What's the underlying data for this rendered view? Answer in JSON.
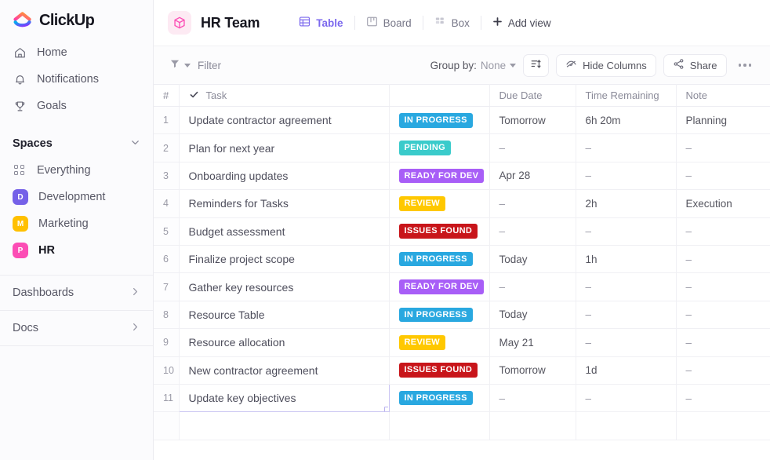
{
  "brand": {
    "name": "ClickUp",
    "accent": "#7b68ee",
    "logo_icon": "clickup-logo-icon"
  },
  "sidebar": {
    "nav": [
      {
        "label": "Home",
        "icon": "home-icon"
      },
      {
        "label": "Notifications",
        "icon": "bell-icon"
      },
      {
        "label": "Goals",
        "icon": "trophy-icon"
      }
    ],
    "spaces_section": {
      "title": "Spaces",
      "chevron_icon": "chevron-down-icon"
    },
    "spaces": [
      {
        "label": "Everything",
        "icon": "grid-dots-icon",
        "initial": "",
        "color": "",
        "active": false
      },
      {
        "label": "Development",
        "icon": "space-badge",
        "initial": "D",
        "color": "#7561e8",
        "active": false
      },
      {
        "label": "Marketing",
        "icon": "space-badge",
        "initial": "M",
        "color": "#ffc000",
        "active": false
      },
      {
        "label": "HR",
        "icon": "space-badge",
        "initial": "P",
        "color": "#fc4db5",
        "active": true
      }
    ],
    "footer": [
      {
        "label": "Dashboards",
        "icon": "chevron-right-icon"
      },
      {
        "label": "Docs",
        "icon": "chevron-right-icon"
      }
    ]
  },
  "header": {
    "list_icon": "box-cube-icon",
    "list_icon_color": "#fc4db5",
    "title": "HR Team",
    "views": [
      {
        "label": "Table",
        "icon": "table-grid-icon",
        "active": true
      },
      {
        "label": "Board",
        "icon": "board-kanban-icon",
        "active": false
      },
      {
        "label": "Box",
        "icon": "box-squares-icon",
        "active": false
      }
    ],
    "add_view": {
      "label": "Add view",
      "icon": "plus-icon"
    }
  },
  "toolbar": {
    "filter": {
      "label": "Filter",
      "icon": "funnel-icon"
    },
    "group_by_label": "Group by:",
    "group_by_value": "None",
    "sort_button_icon": "sort-lines-icon",
    "hide_columns": {
      "label": "Hide Columns",
      "icon": "eye-slash-icon"
    },
    "share": {
      "label": "Share",
      "icon": "share-nodes-icon"
    },
    "more_icon": "ellipsis-icon"
  },
  "table": {
    "columns": [
      "#",
      "Task",
      "",
      "Due Date",
      "Time Remaining",
      "Note"
    ],
    "task_header_check_icon": "check-icon",
    "status_colors": {
      "IN PROGRESS": "#29a8e0",
      "PENDING": "#3acbcb",
      "READY FOR DEV": "#a85ef7",
      "REVIEW": "#ffc800",
      "ISSUES FOUND": "#c8151a"
    },
    "rows": [
      {
        "num": "1",
        "task": "Update contractor agreement",
        "status": "IN PROGRESS",
        "due": "Tomorrow",
        "due_style": "normal",
        "time": "6h 20m",
        "note": "Planning",
        "selected": false
      },
      {
        "num": "2",
        "task": "Plan for next year",
        "status": "PENDING",
        "due": "–",
        "due_style": "dash",
        "time": "–",
        "note": "–",
        "selected": false
      },
      {
        "num": "3",
        "task": "Onboarding updates",
        "status": "READY FOR DEV",
        "due": "Apr 28",
        "due_style": "overdue",
        "time": "–",
        "note": "–",
        "selected": false
      },
      {
        "num": "4",
        "task": "Reminders for Tasks",
        "status": "REVIEW",
        "due": "–",
        "due_style": "dash",
        "time": "2h",
        "note": "Execution",
        "selected": false
      },
      {
        "num": "5",
        "task": "Budget assessment",
        "status": "ISSUES FOUND",
        "due": "–",
        "due_style": "dash",
        "time": "–",
        "note": "–",
        "selected": false
      },
      {
        "num": "6",
        "task": "Finalize project scope",
        "status": "IN PROGRESS",
        "due": "Today",
        "due_style": "today",
        "time": "1h",
        "note": "–",
        "selected": false
      },
      {
        "num": "7",
        "task": "Gather key resources",
        "status": "READY FOR DEV",
        "due": "–",
        "due_style": "dash",
        "time": "–",
        "note": "–",
        "selected": false
      },
      {
        "num": "8",
        "task": "Resource Table",
        "status": "IN PROGRESS",
        "due": "Today",
        "due_style": "today",
        "time": "–",
        "note": "–",
        "selected": false
      },
      {
        "num": "9",
        "task": "Resource allocation",
        "status": "REVIEW",
        "due": "May 21",
        "due_style": "normal",
        "time": "–",
        "note": "–",
        "selected": false
      },
      {
        "num": "10",
        "task": "New contractor agreement",
        "status": "ISSUES FOUND",
        "due": "Tomorrow",
        "due_style": "normal",
        "time": "1d",
        "note": "–",
        "selected": false
      },
      {
        "num": "11",
        "task": "Update key objectives",
        "status": "IN PROGRESS",
        "due": "–",
        "due_style": "dash",
        "time": "–",
        "note": "–",
        "selected": true
      }
    ]
  }
}
